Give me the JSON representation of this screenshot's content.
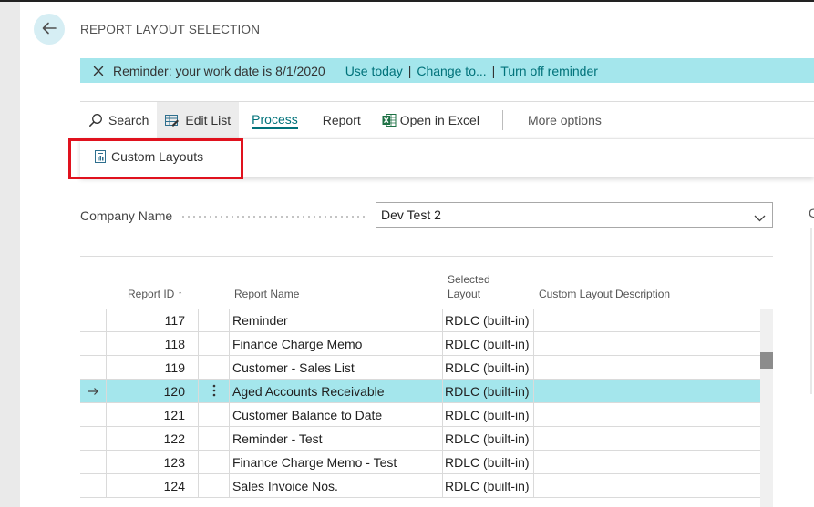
{
  "page": {
    "title": "REPORT LAYOUT SELECTION"
  },
  "notification": {
    "message": "Reminder: your work date is 8/1/2020",
    "links": [
      "Use today",
      "Change to...",
      "Turn off reminder"
    ],
    "separator": "|"
  },
  "actions": {
    "search": "Search",
    "edit_list": "Edit List",
    "process": "Process",
    "report": "Report",
    "open_in_excel": "Open in Excel",
    "more_options": "More options"
  },
  "submenu": {
    "custom_layouts": "Custom Layouts"
  },
  "filter": {
    "label": "Company Name",
    "value": "Dev Test 2"
  },
  "side_panel_glyph": "C",
  "table": {
    "headers": {
      "report_id": "Report ID",
      "sort_arrow": "↑",
      "report_name": "Report Name",
      "selected_layout_1": "Selected",
      "selected_layout_2": "Layout",
      "custom_layout_description": "Custom Layout Description"
    },
    "rows": [
      {
        "id": "117",
        "name": "Reminder",
        "layout": "RDLC (built-in)",
        "desc": ""
      },
      {
        "id": "118",
        "name": "Finance Charge Memo",
        "layout": "RDLC (built-in)",
        "desc": ""
      },
      {
        "id": "119",
        "name": "Customer - Sales List",
        "layout": "RDLC (built-in)",
        "desc": ""
      },
      {
        "id": "120",
        "name": "Aged Accounts Receivable",
        "layout": "RDLC (built-in)",
        "desc": "",
        "selected": true
      },
      {
        "id": "121",
        "name": "Customer Balance to Date",
        "layout": "RDLC (built-in)",
        "desc": ""
      },
      {
        "id": "122",
        "name": "Reminder - Test",
        "layout": "RDLC (built-in)",
        "desc": ""
      },
      {
        "id": "123",
        "name": "Finance Charge Memo - Test",
        "layout": "RDLC (built-in)",
        "desc": ""
      },
      {
        "id": "124",
        "name": "Sales Invoice Nos.",
        "layout": "RDLC (built-in)",
        "desc": ""
      }
    ]
  },
  "colors": {
    "accent": "#00727a",
    "notice_bg": "#a4e6ec",
    "selected_row_bg": "#a4e6ec",
    "highlight_box": "#e0121e",
    "back_button_bg": "#d6eef4"
  },
  "icons": {
    "back": "arrow-left-icon",
    "close": "close-icon",
    "search": "search-icon",
    "edit_list": "edit-list-icon",
    "excel": "excel-icon",
    "custom_layouts": "report-layout-icon",
    "dropdown": "chevron-down-icon",
    "row_arrow": "row-selected-arrow-icon",
    "row_menu": "more-vertical-icon"
  }
}
